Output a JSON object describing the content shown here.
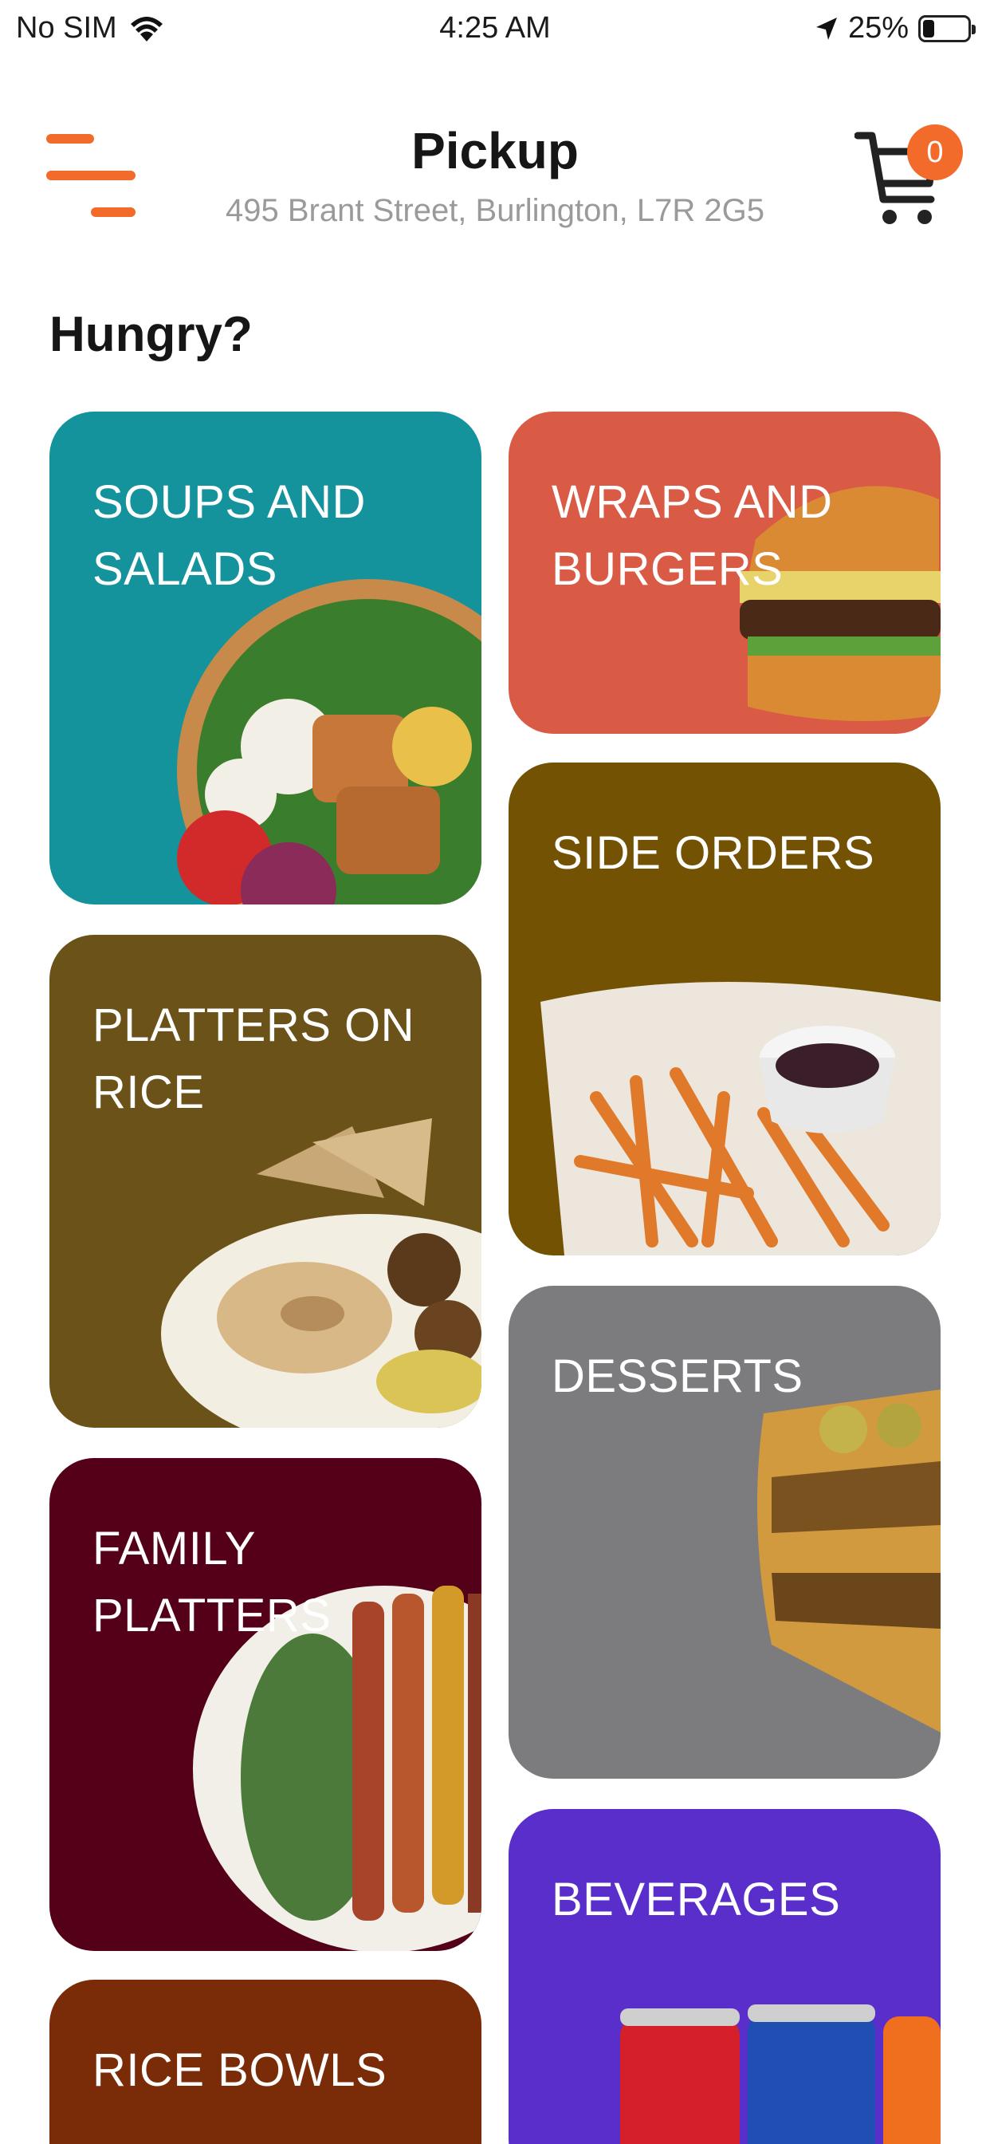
{
  "status_bar": {
    "carrier": "No SIM",
    "time": "4:25 AM",
    "battery_percent": "25%",
    "battery_level": 0.25,
    "icons": [
      "wifi-icon",
      "location-arrow-icon",
      "battery-icon"
    ]
  },
  "header": {
    "title": "Pickup",
    "address": "495 Brant Street, Burlington, L7R 2G5",
    "cart_count": "0",
    "icons": [
      "menu-icon",
      "cart-icon"
    ]
  },
  "section_title": "Hungry?",
  "categories": [
    {
      "label": "SOUPS AND SALADS",
      "color": "#15939c"
    },
    {
      "label": "WRAPS AND BURGERS",
      "color": "#d95b45"
    },
    {
      "label": "SIDE ORDERS",
      "color": "#735203"
    },
    {
      "label": "PLATTERS ON RICE",
      "color": "#6b5218"
    },
    {
      "label": "DESSERTS",
      "color": "#7c7b7d"
    },
    {
      "label": "FAMILY PLATTERS",
      "color": "#530018"
    },
    {
      "label": "BEVERAGES",
      "color": "#5a2ecb"
    },
    {
      "label": "RICE BOWLS",
      "color": "#7a2b08"
    }
  ],
  "colors": {
    "accent": "#f26b2b"
  }
}
